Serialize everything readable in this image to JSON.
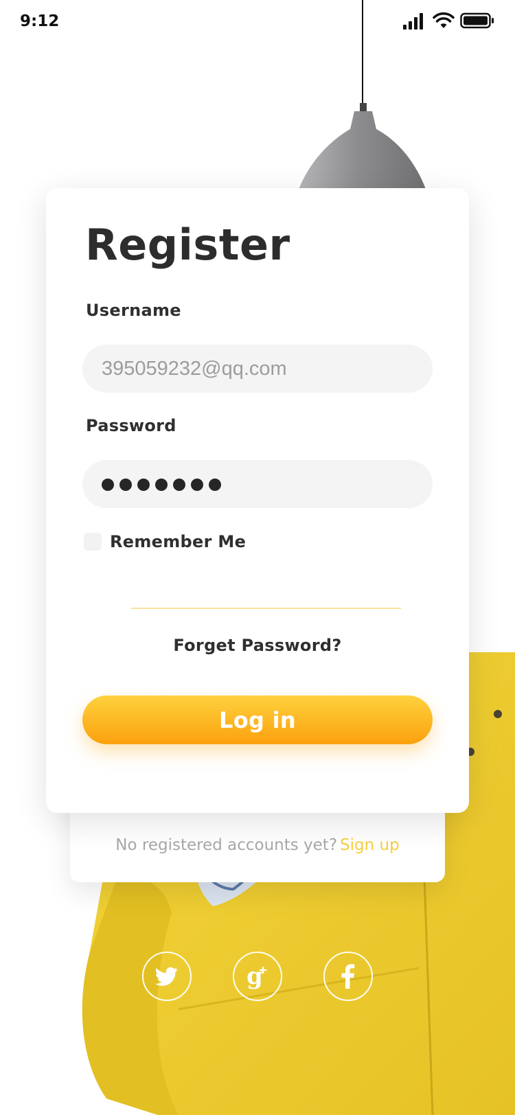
{
  "status_bar": {
    "time": "9:12"
  },
  "card": {
    "title": "Register",
    "username": {
      "label": "Username",
      "value": "395059232@qq.com"
    },
    "password": {
      "label": "Password",
      "value": "•••••••",
      "dot_count": 7
    },
    "remember_me_label": "Remember Me",
    "forgot_password": "Forget Password?",
    "login_button": "Log in"
  },
  "signup": {
    "prompt": "No registered accounts yet?",
    "link": "Sign up"
  },
  "social": [
    {
      "name": "twitter",
      "icon": "twitter-icon"
    },
    {
      "name": "google-plus",
      "icon": "google-plus-icon"
    },
    {
      "name": "facebook",
      "icon": "facebook-icon"
    }
  ],
  "colors": {
    "accent": "#fba10d",
    "accent_light": "#ffd13e",
    "sofa": "#f0cf2d",
    "link": "#f7cf3d",
    "input_bg": "#f4f4f4"
  }
}
